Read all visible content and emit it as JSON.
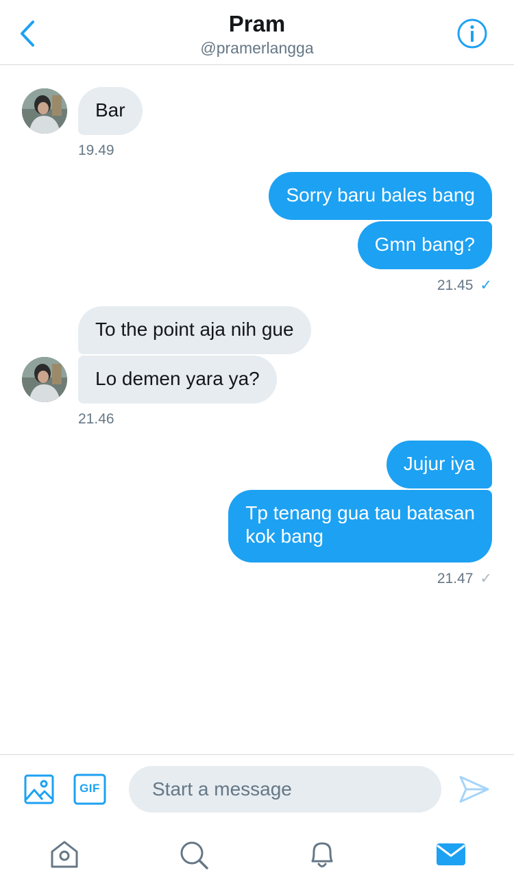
{
  "header": {
    "title": "Pram",
    "username": "@pramerlangga",
    "back_icon": "chevron-left-icon",
    "info_icon": "info-icon"
  },
  "messages": [
    {
      "direction": "in",
      "text": "Bar",
      "time": "19.49"
    },
    {
      "direction": "out",
      "text": "Sorry baru bales bang"
    },
    {
      "direction": "out",
      "text": "Gmn bang?",
      "time": "21.45",
      "status": "✓"
    },
    {
      "direction": "in",
      "text": "To the point aja nih gue"
    },
    {
      "direction": "in",
      "text": "Lo demen yara ya?",
      "time": "21.46"
    },
    {
      "direction": "out",
      "text": "Jujur iya"
    },
    {
      "direction": "out",
      "text_line1": "Tp tenang gua tau batasan",
      "text_line2": "kok bang",
      "time": "21.47",
      "status": "✓"
    }
  ],
  "composer": {
    "placeholder": "Start a message",
    "gif_label": "GIF",
    "image_icon": "image-icon",
    "send_icon": "send-icon"
  },
  "tabbar": {
    "items": [
      "home-icon",
      "search-icon",
      "notifications-icon",
      "messages-icon"
    ],
    "active": "messages-icon"
  },
  "colors": {
    "accent": "#1da1f2",
    "incoming_bubble": "#e6ecf0",
    "secondary_text": "#657786",
    "divider": "#d5d9dc"
  }
}
